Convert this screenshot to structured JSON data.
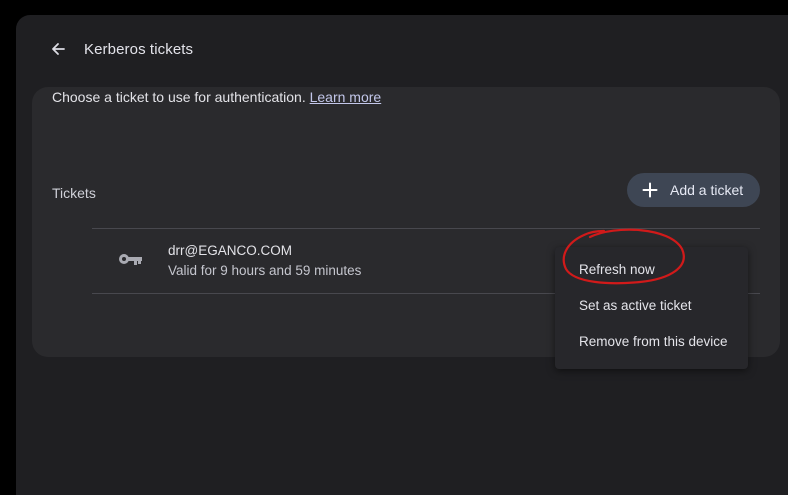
{
  "header": {
    "title": "Kerberos tickets",
    "back_icon": "arrow-left-icon"
  },
  "card": {
    "intro_text": "Choose a ticket to use for authentication.",
    "learn_more": "Learn more",
    "section_label": "Tickets",
    "add_button_label": "Add a ticket",
    "add_icon": "plus-icon"
  },
  "tickets": [
    {
      "name": "drr@EGANCO.COM",
      "validity": "Valid for 9 hours and 59 minutes",
      "icon": "key-icon"
    }
  ],
  "context_menu": {
    "items": [
      {
        "label": "Refresh now"
      },
      {
        "label": "Set as active ticket"
      },
      {
        "label": "Remove from this device"
      }
    ]
  },
  "colors": {
    "window_bg": "#1f1f22",
    "card_bg": "#2a2a2d",
    "button_bg": "#3e4654",
    "annotation": "#d11a1a"
  }
}
